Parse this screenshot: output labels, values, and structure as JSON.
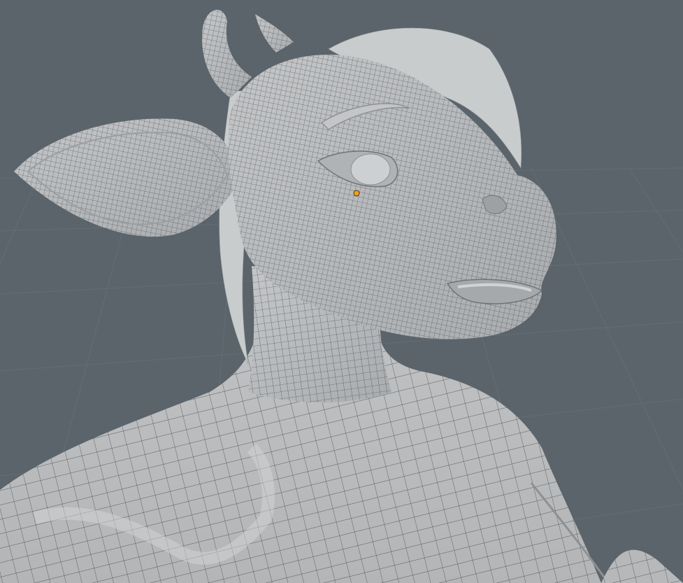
{
  "app": {
    "view": "3d-viewport",
    "shading": "solid-wireframe",
    "background_color": "#5b646a",
    "grid_color": "#66707a"
  },
  "scene": {
    "subject": "stylized-cow-character-bust",
    "mesh_color": "#b9bbbd",
    "wire_color": "#3a3d40",
    "hair_color": "#c9cccd",
    "origin_color": "#f0a018"
  }
}
